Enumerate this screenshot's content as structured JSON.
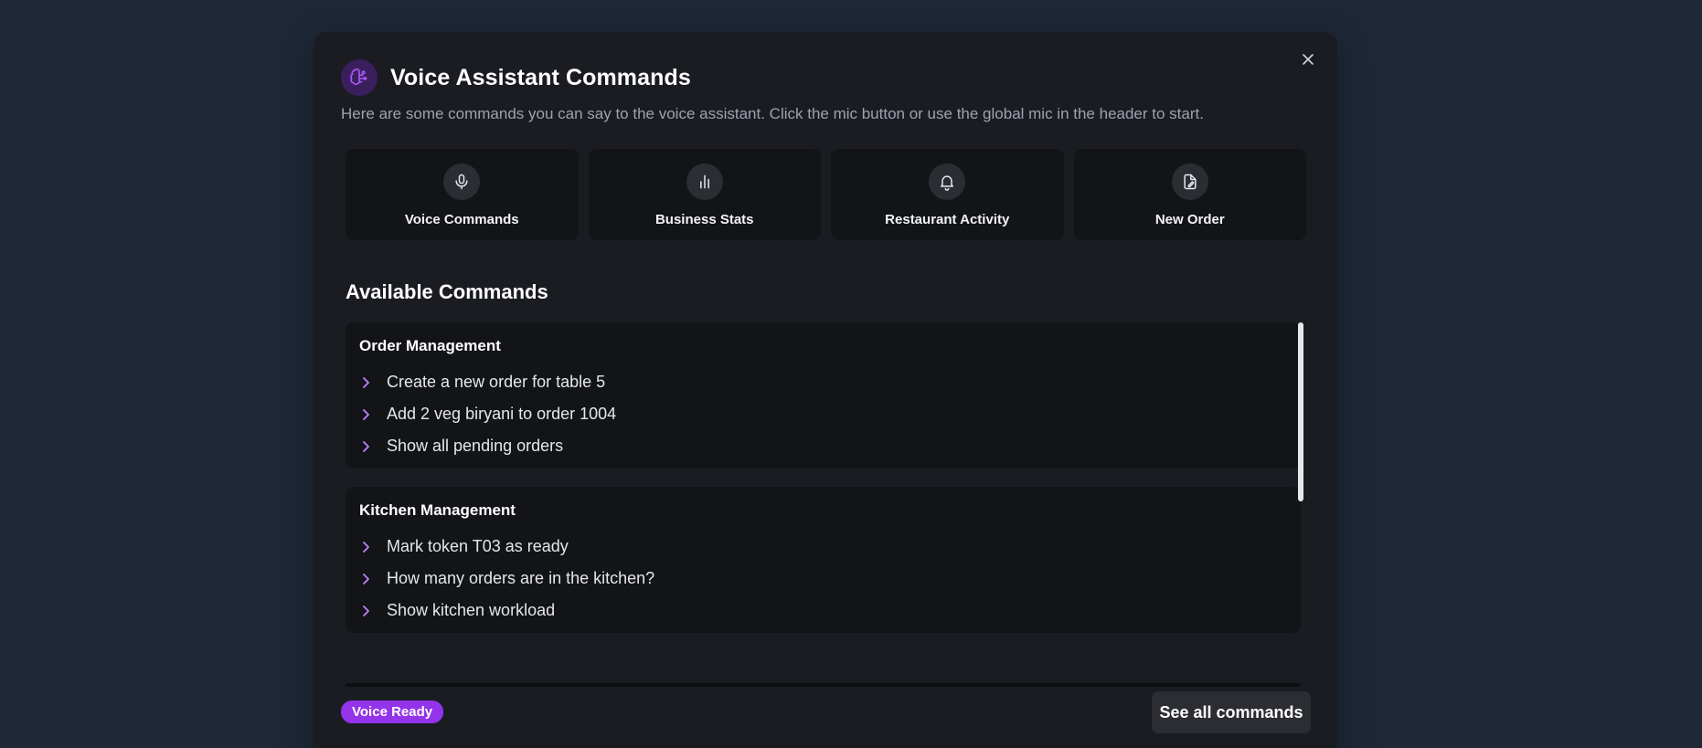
{
  "modal": {
    "title": "Voice Assistant Commands",
    "subtitle": "Here are some commands you can say to the voice assistant. Click the mic button or use the global mic in the header to start.",
    "header_icon": "brain-icon",
    "close_icon": "close-icon"
  },
  "cards": [
    {
      "label": "Voice Commands",
      "icon": "microphone-icon"
    },
    {
      "label": "Business Stats",
      "icon": "bar-chart-icon"
    },
    {
      "label": "Restaurant Activity",
      "icon": "bell-icon"
    },
    {
      "label": "New Order",
      "icon": "file-edit-icon"
    }
  ],
  "section_title": "Available Commands",
  "groups": [
    {
      "title": "Order Management",
      "commands": [
        "Create a new order for table 5",
        "Add 2 veg biryani to order 1004",
        "Show all pending orders"
      ]
    },
    {
      "title": "Kitchen Management",
      "commands": [
        "Mark token T03 as ready",
        "How many orders are in the kitchen?",
        "Show kitchen workload"
      ]
    }
  ],
  "footer": {
    "status_badge": "Voice Ready",
    "see_all_label": "See all commands"
  },
  "colors": {
    "accent": "#9333ea",
    "chevron": "#c084fc",
    "background": "#1e2837",
    "modal": "#1a1c22"
  }
}
